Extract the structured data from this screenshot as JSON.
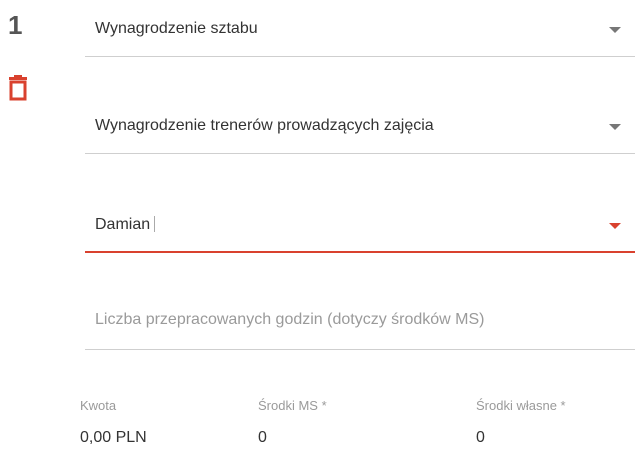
{
  "row": {
    "index": "1",
    "delete_icon": "trash-icon",
    "accent_color": "#d9412e"
  },
  "fields": {
    "category": {
      "value": "Wynagrodzenie sztabu",
      "icon": "chevron-down-icon"
    },
    "subcategory": {
      "value": "Wynagrodzenie trenerów prowadzących zajęcia",
      "icon": "chevron-down-icon"
    },
    "person": {
      "value": "Damian",
      "icon": "chevron-down-icon"
    },
    "hours": {
      "placeholder": "Liczba przepracowanych godzin (dotyczy środków MS)"
    }
  },
  "summary": {
    "kwota": {
      "label": "Kwota",
      "value": "0,00 PLN"
    },
    "srodki_ms": {
      "label": "Środki MS *",
      "value": "0"
    },
    "srodki_wlasne": {
      "label": "Środki własne *",
      "value": "0"
    }
  }
}
